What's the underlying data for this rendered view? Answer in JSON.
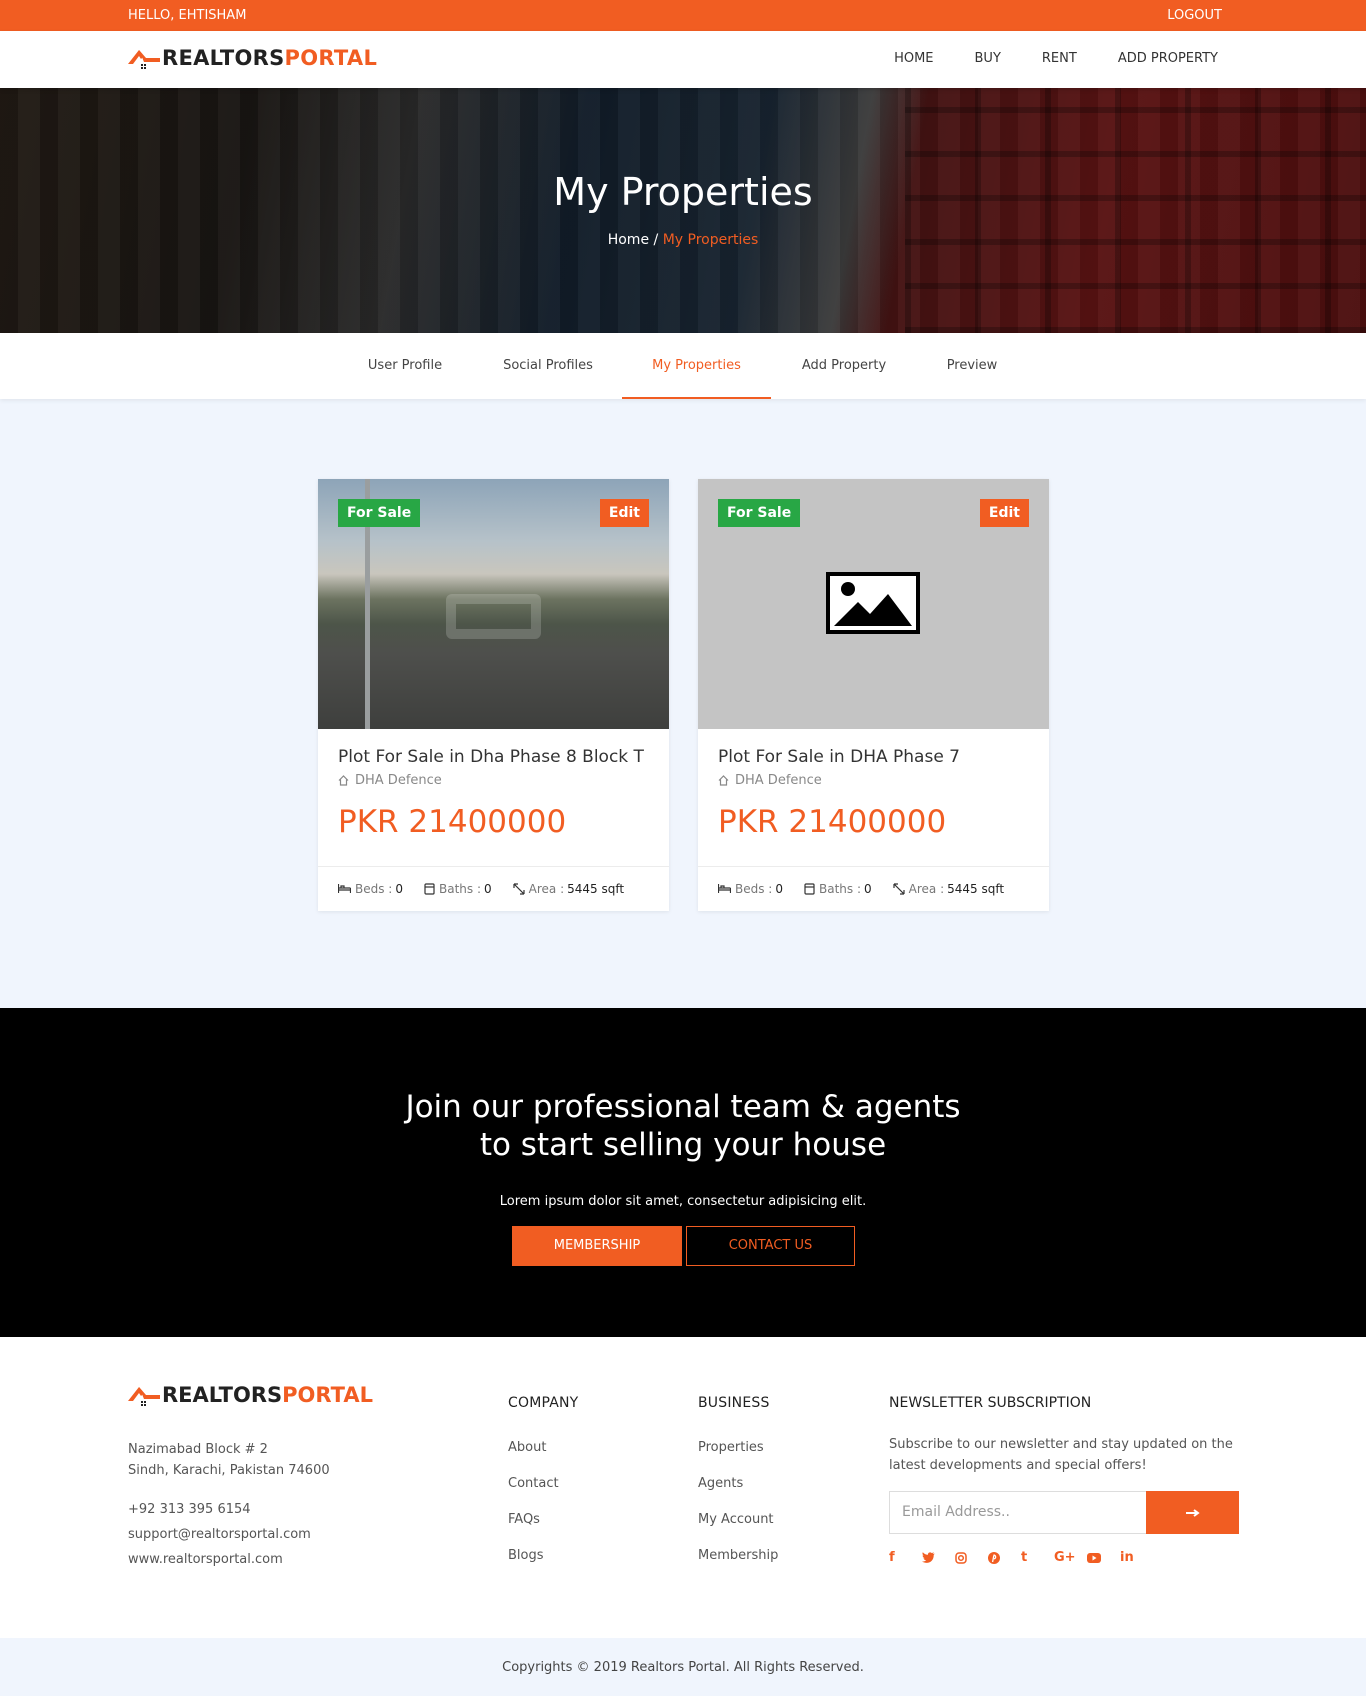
{
  "topbar": {
    "greeting": "HELLO, EHTISHAM",
    "logout": "LOGOUT"
  },
  "brand": {
    "part1": "REALTORS",
    "part2": "PORTAL",
    "accent": "#f15d22"
  },
  "nav": {
    "items": [
      "HOME",
      "BUY",
      "RENT",
      "ADD PROPERTY"
    ]
  },
  "hero": {
    "title": "My Properties",
    "crumb_home": "Home",
    "crumb_sep": "/",
    "crumb_current": "My Properties"
  },
  "tabs": {
    "items": [
      "User Profile",
      "Social Profiles",
      "My Properties",
      "Add Property",
      "Preview"
    ],
    "active": "My Properties"
  },
  "properties": [
    {
      "status": "For Sale",
      "edit": "Edit",
      "image": "photo",
      "title": "Plot For Sale in Dha Phase 8 Block T",
      "location": "DHA Defence",
      "price": "PKR 21400000",
      "beds_label": "Beds :",
      "beds": "0",
      "baths_label": "Baths :",
      "baths": "0",
      "area_label": "Area :",
      "area": "5445 sqft"
    },
    {
      "status": "For Sale",
      "edit": "Edit",
      "image": "placeholder-image-icon",
      "title": "Plot For Sale in DHA Phase 7",
      "location": "DHA Defence",
      "price": "PKR 21400000",
      "beds_label": "Beds :",
      "beds": "0",
      "baths_label": "Baths :",
      "baths": "0",
      "area_label": "Area :",
      "area": "5445 sqft"
    }
  ],
  "cta": {
    "title_line1": "Join our professional team & agents",
    "title_line2": "to start selling your house",
    "text": "Lorem ipsum dolor sit amet, consectetur adipisicing elit.",
    "membership": "MEMBERSHIP",
    "contact": "CONTACT US"
  },
  "footer": {
    "address_line1": "Nazimabad Block # 2",
    "address_line2": "Sindh, Karachi, Pakistan 74600",
    "phone": "+92 313 395 6154",
    "email": "support@realtorsportal.com",
    "website": "www.realtorsportal.com",
    "company": {
      "title": "COMPANY",
      "links": [
        "About",
        "Contact",
        "FAQs",
        "Blogs"
      ]
    },
    "business": {
      "title": "BUSINESS",
      "links": [
        "Properties",
        "Agents",
        "My Account",
        "Membership"
      ]
    },
    "newsletter": {
      "title": "NEWSLETTER SUBSCRIPTION",
      "text": "Subscribe to our newsletter and stay updated on the latest developments and special offers!",
      "placeholder": "Email Address..",
      "social": [
        "facebook-icon",
        "twitter-icon",
        "instagram-icon",
        "pinterest-icon",
        "tumblr-icon",
        "google-plus-icon",
        "youtube-icon",
        "linkedin-icon"
      ]
    },
    "copyright": "Copyrights © 2019 Realtors Portal. All Rights Reserved."
  }
}
